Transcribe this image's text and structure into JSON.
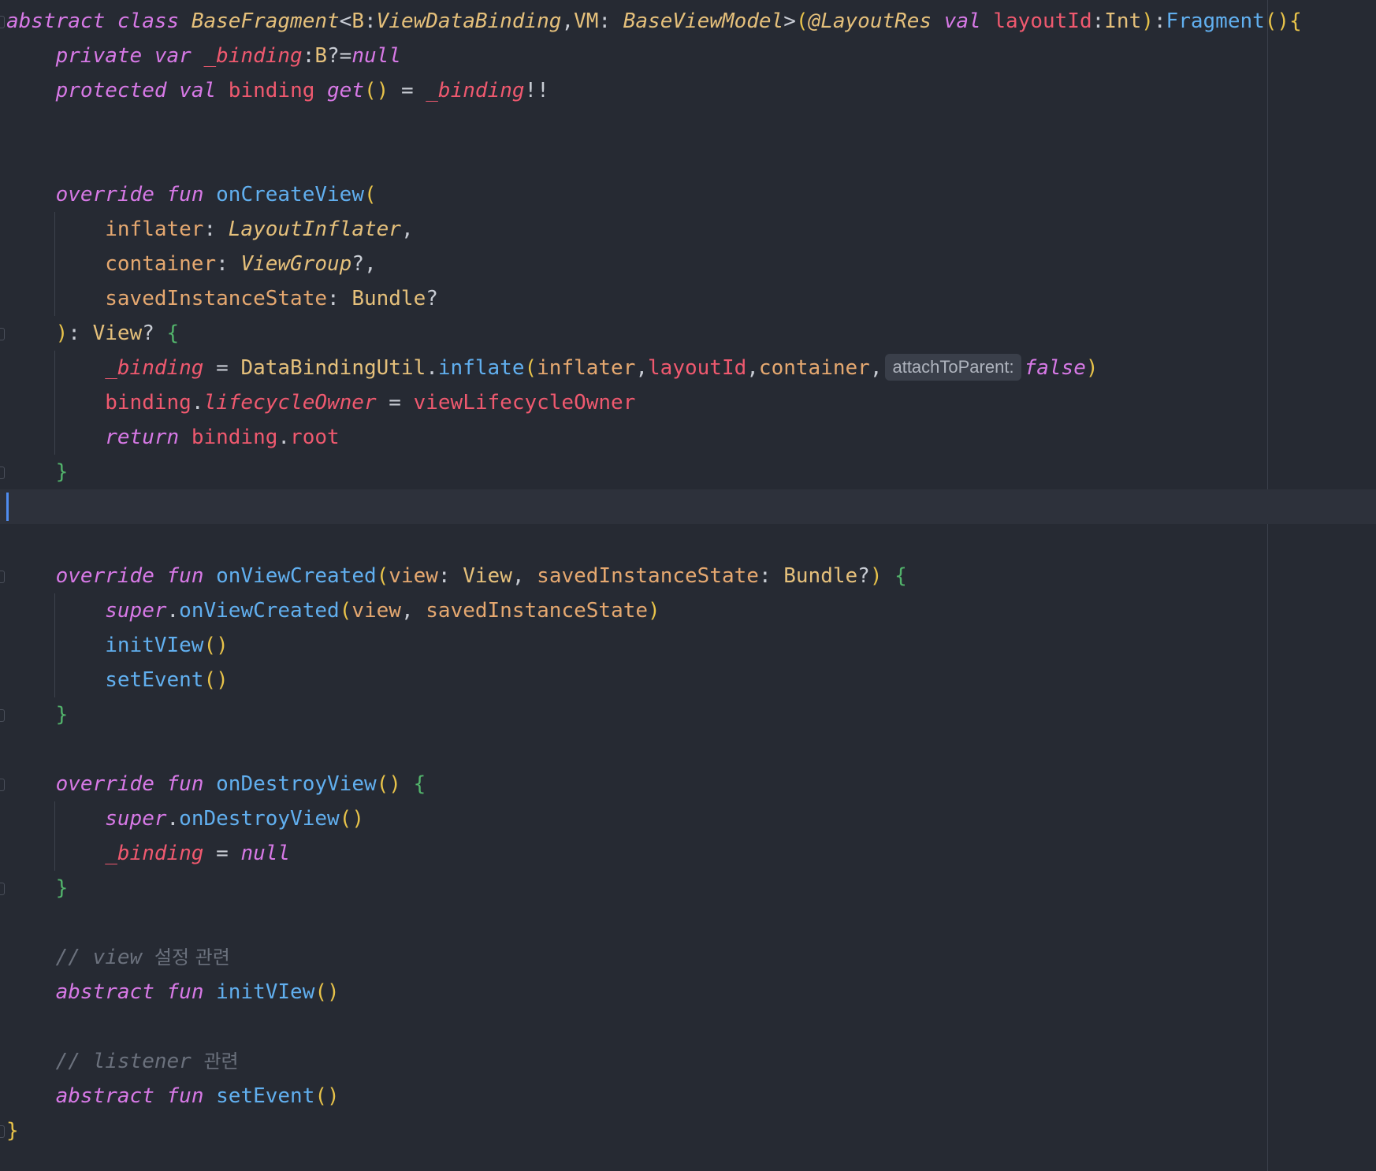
{
  "editor": {
    "language": "Kotlin",
    "current_line_index": 14,
    "colors": {
      "background": "#262a33",
      "current_line": "#2d313b",
      "keyword": "#d779e6",
      "type": "#e5c07b",
      "property": "#ef596f",
      "function": "#61afef",
      "parameter": "#e5a870",
      "comment": "#6b717d",
      "brace": "#52b36b",
      "caret": "#4f8cf0"
    },
    "lines": [
      [
        {
          "t": "abstract",
          "c": "kw"
        },
        {
          "t": " ",
          "c": "pn"
        },
        {
          "t": "class",
          "c": "kw"
        },
        {
          "t": " ",
          "c": "pn"
        },
        {
          "t": "BaseFragment",
          "c": "cls"
        },
        {
          "t": "<",
          "c": "pun"
        },
        {
          "t": "B",
          "c": "typ"
        },
        {
          "t": ":",
          "c": "pun"
        },
        {
          "t": "ViewDataBinding",
          "c": "cls"
        },
        {
          "t": ",",
          "c": "pun"
        },
        {
          "t": "VM",
          "c": "typ"
        },
        {
          "t": ": ",
          "c": "pun"
        },
        {
          "t": "BaseViewModel",
          "c": "cls"
        },
        {
          "t": ">",
          "c": "pun"
        },
        {
          "t": "(",
          "c": "br"
        },
        {
          "t": "@LayoutRes",
          "c": "cls"
        },
        {
          "t": " ",
          "c": "pn"
        },
        {
          "t": "val",
          "c": "kw"
        },
        {
          "t": " ",
          "c": "pn"
        },
        {
          "t": "layoutId",
          "c": "prop"
        },
        {
          "t": ":",
          "c": "pun"
        },
        {
          "t": "Int",
          "c": "typ"
        },
        {
          "t": ")",
          "c": "br"
        },
        {
          "t": ":",
          "c": "pun"
        },
        {
          "t": "Fragment",
          "c": "fn"
        },
        {
          "t": "()",
          "c": "br"
        },
        {
          "t": "{",
          "c": "br"
        }
      ],
      [
        {
          "t": "    ",
          "c": "pn"
        },
        {
          "t": "private",
          "c": "kw"
        },
        {
          "t": " ",
          "c": "pn"
        },
        {
          "t": "var",
          "c": "kw"
        },
        {
          "t": " ",
          "c": "pn"
        },
        {
          "t": "_binding",
          "c": "propi"
        },
        {
          "t": ":",
          "c": "pun"
        },
        {
          "t": "B",
          "c": "typ"
        },
        {
          "t": "?=",
          "c": "pun"
        },
        {
          "t": "null",
          "c": "kw"
        }
      ],
      [
        {
          "t": "    ",
          "c": "pn"
        },
        {
          "t": "protected",
          "c": "kw"
        },
        {
          "t": " ",
          "c": "pn"
        },
        {
          "t": "val",
          "c": "kw"
        },
        {
          "t": " ",
          "c": "pn"
        },
        {
          "t": "binding",
          "c": "prop"
        },
        {
          "t": " ",
          "c": "pn"
        },
        {
          "t": "get",
          "c": "kw"
        },
        {
          "t": "()",
          "c": "br"
        },
        {
          "t": " = ",
          "c": "pun"
        },
        {
          "t": "_binding",
          "c": "propi"
        },
        {
          "t": "!!",
          "c": "pun"
        }
      ],
      [],
      [],
      [
        {
          "t": "    ",
          "c": "pn"
        },
        {
          "t": "override",
          "c": "kw"
        },
        {
          "t": " ",
          "c": "pn"
        },
        {
          "t": "fun",
          "c": "kw"
        },
        {
          "t": " ",
          "c": "pn"
        },
        {
          "t": "onCreateView",
          "c": "fn"
        },
        {
          "t": "(",
          "c": "br"
        }
      ],
      [
        {
          "t": "        ",
          "c": "pn"
        },
        {
          "t": "inflater",
          "c": "param"
        },
        {
          "t": ": ",
          "c": "pun"
        },
        {
          "t": "LayoutInflater",
          "c": "cls"
        },
        {
          "t": ",",
          "c": "pun"
        }
      ],
      [
        {
          "t": "        ",
          "c": "pn"
        },
        {
          "t": "container",
          "c": "param"
        },
        {
          "t": ": ",
          "c": "pun"
        },
        {
          "t": "ViewGroup",
          "c": "cls"
        },
        {
          "t": "?,",
          "c": "pun"
        }
      ],
      [
        {
          "t": "        ",
          "c": "pn"
        },
        {
          "t": "savedInstanceState",
          "c": "param"
        },
        {
          "t": ": ",
          "c": "pun"
        },
        {
          "t": "Bundle",
          "c": "typ"
        },
        {
          "t": "?",
          "c": "pun"
        }
      ],
      [
        {
          "t": "    ",
          "c": "pn"
        },
        {
          "t": ")",
          "c": "br"
        },
        {
          "t": ": ",
          "c": "pun"
        },
        {
          "t": "View",
          "c": "typ"
        },
        {
          "t": "? ",
          "c": "pun"
        },
        {
          "t": "{",
          "c": "br2"
        }
      ],
      [
        {
          "t": "        ",
          "c": "pn"
        },
        {
          "t": "_binding",
          "c": "propi"
        },
        {
          "t": " = ",
          "c": "pun"
        },
        {
          "t": "DataBindingUtil",
          "c": "typ"
        },
        {
          "t": ".",
          "c": "pun"
        },
        {
          "t": "inflate",
          "c": "fn"
        },
        {
          "t": "(",
          "c": "br"
        },
        {
          "t": "inflater",
          "c": "param"
        },
        {
          "t": ",",
          "c": "pun"
        },
        {
          "t": "layoutId",
          "c": "prop"
        },
        {
          "t": ",",
          "c": "pun"
        },
        {
          "t": "container",
          "c": "param"
        },
        {
          "t": ",",
          "c": "pun"
        },
        {
          "t": "attachToParent:",
          "c": "hint"
        },
        {
          "t": "false",
          "c": "kw"
        },
        {
          "t": ")",
          "c": "br"
        }
      ],
      [
        {
          "t": "        ",
          "c": "pn"
        },
        {
          "t": "binding",
          "c": "prop"
        },
        {
          "t": ".",
          "c": "pun"
        },
        {
          "t": "lifecycleOwner",
          "c": "propi"
        },
        {
          "t": " = ",
          "c": "pun"
        },
        {
          "t": "viewLifecycleOwner",
          "c": "prop"
        }
      ],
      [
        {
          "t": "        ",
          "c": "pn"
        },
        {
          "t": "return",
          "c": "kw"
        },
        {
          "t": " ",
          "c": "pn"
        },
        {
          "t": "binding",
          "c": "prop"
        },
        {
          "t": ".",
          "c": "pun"
        },
        {
          "t": "root",
          "c": "prop"
        }
      ],
      [
        {
          "t": "    ",
          "c": "pn"
        },
        {
          "t": "}",
          "c": "br2"
        }
      ],
      [],
      [],
      [
        {
          "t": "    ",
          "c": "pn"
        },
        {
          "t": "override",
          "c": "kw"
        },
        {
          "t": " ",
          "c": "pn"
        },
        {
          "t": "fun",
          "c": "kw"
        },
        {
          "t": " ",
          "c": "pn"
        },
        {
          "t": "onViewCreated",
          "c": "fn"
        },
        {
          "t": "(",
          "c": "br"
        },
        {
          "t": "view",
          "c": "param"
        },
        {
          "t": ": ",
          "c": "pun"
        },
        {
          "t": "View",
          "c": "typ"
        },
        {
          "t": ", ",
          "c": "pun"
        },
        {
          "t": "savedInstanceState",
          "c": "param"
        },
        {
          "t": ": ",
          "c": "pun"
        },
        {
          "t": "Bundle",
          "c": "typ"
        },
        {
          "t": "?",
          "c": "pun"
        },
        {
          "t": ")",
          "c": "br"
        },
        {
          "t": " ",
          "c": "pn"
        },
        {
          "t": "{",
          "c": "br2"
        }
      ],
      [
        {
          "t": "        ",
          "c": "pn"
        },
        {
          "t": "super",
          "c": "kw"
        },
        {
          "t": ".",
          "c": "pun"
        },
        {
          "t": "onViewCreated",
          "c": "fn"
        },
        {
          "t": "(",
          "c": "br"
        },
        {
          "t": "view",
          "c": "param"
        },
        {
          "t": ", ",
          "c": "pun"
        },
        {
          "t": "savedInstanceState",
          "c": "param"
        },
        {
          "t": ")",
          "c": "br"
        }
      ],
      [
        {
          "t": "        ",
          "c": "pn"
        },
        {
          "t": "initVIew",
          "c": "fn"
        },
        {
          "t": "()",
          "c": "br"
        }
      ],
      [
        {
          "t": "        ",
          "c": "pn"
        },
        {
          "t": "setEvent",
          "c": "fn"
        },
        {
          "t": "()",
          "c": "br"
        }
      ],
      [
        {
          "t": "    ",
          "c": "pn"
        },
        {
          "t": "}",
          "c": "br2"
        }
      ],
      [],
      [
        {
          "t": "    ",
          "c": "pn"
        },
        {
          "t": "override",
          "c": "kw"
        },
        {
          "t": " ",
          "c": "pn"
        },
        {
          "t": "fun",
          "c": "kw"
        },
        {
          "t": " ",
          "c": "pn"
        },
        {
          "t": "onDestroyView",
          "c": "fn"
        },
        {
          "t": "()",
          "c": "br"
        },
        {
          "t": " ",
          "c": "pn"
        },
        {
          "t": "{",
          "c": "br2"
        }
      ],
      [
        {
          "t": "        ",
          "c": "pn"
        },
        {
          "t": "super",
          "c": "kw"
        },
        {
          "t": ".",
          "c": "pun"
        },
        {
          "t": "onDestroyView",
          "c": "fn"
        },
        {
          "t": "()",
          "c": "br"
        }
      ],
      [
        {
          "t": "        ",
          "c": "pn"
        },
        {
          "t": "_binding",
          "c": "propi"
        },
        {
          "t": " = ",
          "c": "pun"
        },
        {
          "t": "null",
          "c": "kw"
        }
      ],
      [
        {
          "t": "    ",
          "c": "pn"
        },
        {
          "t": "}",
          "c": "br2"
        }
      ],
      [],
      [
        {
          "t": "    ",
          "c": "pn"
        },
        {
          "t": "// view ",
          "c": "cmt"
        },
        {
          "t": "설정 관련",
          "c": "cmtk"
        }
      ],
      [
        {
          "t": "    ",
          "c": "pn"
        },
        {
          "t": "abstract",
          "c": "kw"
        },
        {
          "t": " ",
          "c": "pn"
        },
        {
          "t": "fun",
          "c": "kw"
        },
        {
          "t": " ",
          "c": "pn"
        },
        {
          "t": "initVIew",
          "c": "fn"
        },
        {
          "t": "()",
          "c": "br"
        }
      ],
      [],
      [
        {
          "t": "    ",
          "c": "pn"
        },
        {
          "t": "// listener ",
          "c": "cmt"
        },
        {
          "t": "관련",
          "c": "cmtk"
        }
      ],
      [
        {
          "t": "    ",
          "c": "pn"
        },
        {
          "t": "abstract",
          "c": "kw"
        },
        {
          "t": " ",
          "c": "pn"
        },
        {
          "t": "fun",
          "c": "kw"
        },
        {
          "t": " ",
          "c": "pn"
        },
        {
          "t": "setEvent",
          "c": "fn"
        },
        {
          "t": "()",
          "c": "br"
        }
      ],
      [
        {
          "t": "}",
          "c": "br"
        }
      ]
    ]
  }
}
